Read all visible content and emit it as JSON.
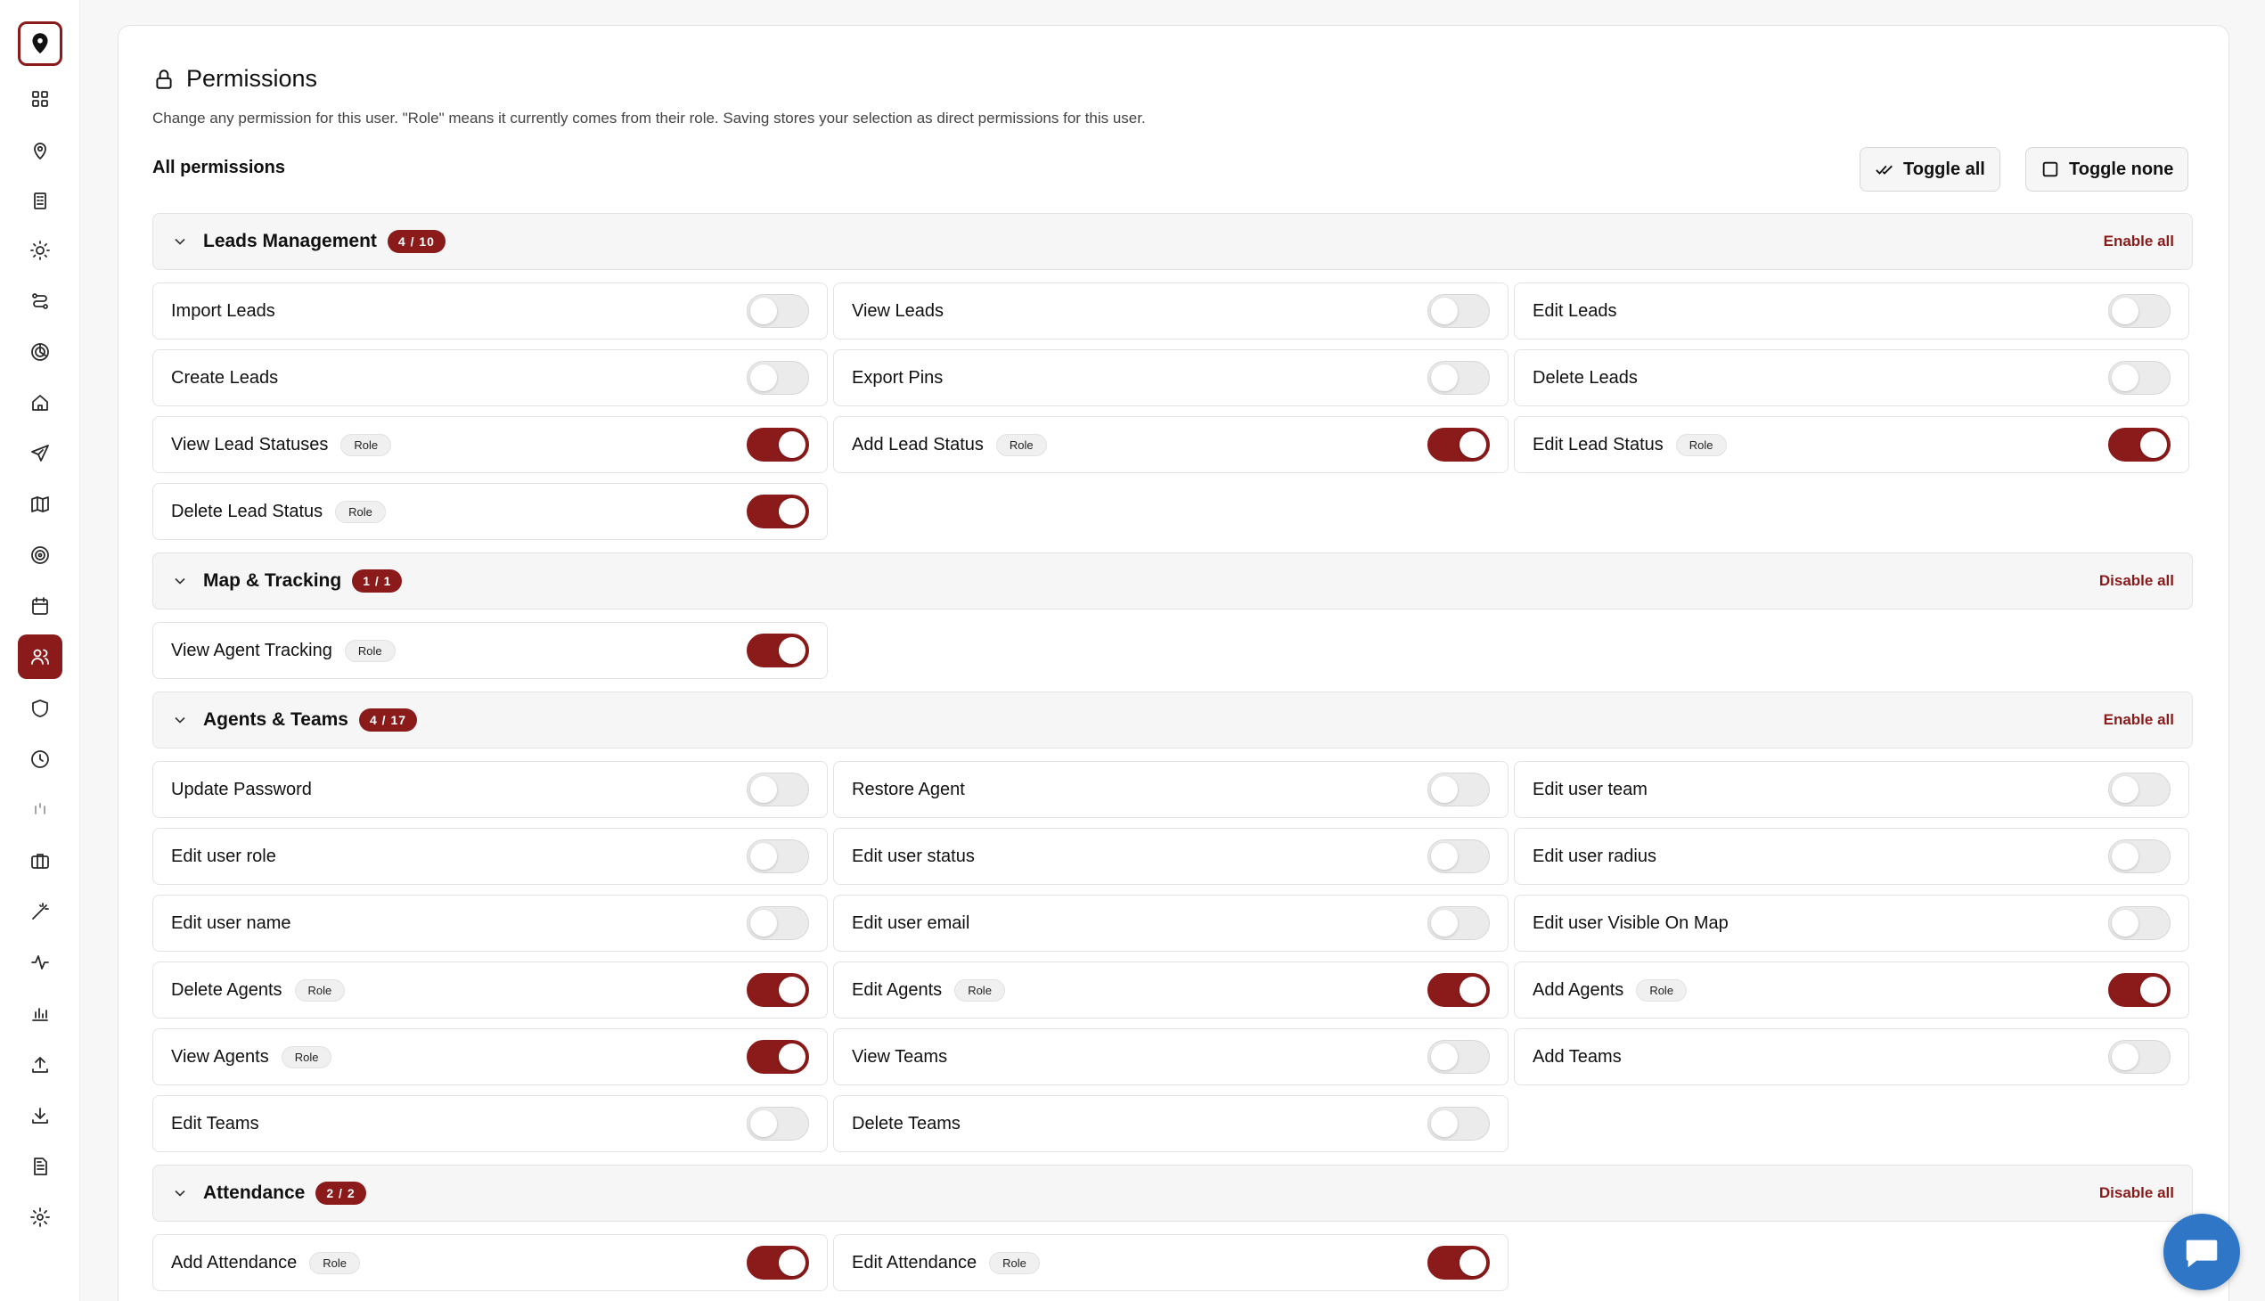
{
  "sidebar": {
    "icons": [
      "map-pin-logo-icon",
      "grid-icon",
      "location-icon",
      "building-icon",
      "sun-icon",
      "route-icon",
      "target-spiral-icon",
      "home-icon",
      "send-icon",
      "map-icon",
      "target-icon",
      "calendar-icon",
      "users-icon",
      "shield-icon",
      "clock-icon",
      "bars-faded-icon",
      "briefcase-icon",
      "magic-wand-icon",
      "activity-icon",
      "bar-chart-icon",
      "upload-icon",
      "download-icon",
      "document-icon",
      "settings-icon"
    ],
    "active": "users-icon"
  },
  "header": {
    "title": "Permissions",
    "description": "Change any permission for this user. \"Role\" means it currently comes from their role. Saving stores your selection as direct permissions for this user.",
    "all_label": "All permissions",
    "toggle_all": "Toggle all",
    "toggle_none": "Toggle none"
  },
  "colors": {
    "accent": "#8b1a1a",
    "chat": "#2f77c6"
  },
  "sections": [
    {
      "title": "Leads Management",
      "count": "4 / 10",
      "action": "Enable all",
      "items": [
        {
          "label": "Import Leads",
          "on": false,
          "role": ""
        },
        {
          "label": "View Leads",
          "on": false,
          "role": ""
        },
        {
          "label": "Edit Leads",
          "on": false,
          "role": ""
        },
        {
          "label": "Create Leads",
          "on": false,
          "role": ""
        },
        {
          "label": "Export Pins",
          "on": false,
          "role": ""
        },
        {
          "label": "Delete Leads",
          "on": false,
          "role": ""
        },
        {
          "label": "View Lead Statuses",
          "on": true,
          "role": "Role"
        },
        {
          "label": "Add Lead Status",
          "on": true,
          "role": "Role"
        },
        {
          "label": "Edit Lead Status",
          "on": true,
          "role": "Role"
        },
        {
          "label": "Delete Lead Status",
          "on": true,
          "role": "Role"
        }
      ]
    },
    {
      "title": "Map & Tracking",
      "count": "1 / 1",
      "action": "Disable all",
      "items": [
        {
          "label": "View Agent Tracking",
          "on": true,
          "role": "Role"
        }
      ]
    },
    {
      "title": "Agents & Teams",
      "count": "4 / 17",
      "action": "Enable all",
      "items": [
        {
          "label": "Update Password",
          "on": false,
          "role": ""
        },
        {
          "label": "Restore Agent",
          "on": false,
          "role": ""
        },
        {
          "label": "Edit user team",
          "on": false,
          "role": ""
        },
        {
          "label": "Edit user role",
          "on": false,
          "role": ""
        },
        {
          "label": "Edit user status",
          "on": false,
          "role": ""
        },
        {
          "label": "Edit user radius",
          "on": false,
          "role": ""
        },
        {
          "label": "Edit user name",
          "on": false,
          "role": ""
        },
        {
          "label": "Edit user email",
          "on": false,
          "role": ""
        },
        {
          "label": "Edit user Visible On Map",
          "on": false,
          "role": ""
        },
        {
          "label": "Delete Agents",
          "on": true,
          "role": "Role"
        },
        {
          "label": "Edit Agents",
          "on": true,
          "role": "Role"
        },
        {
          "label": "Add Agents",
          "on": true,
          "role": "Role"
        },
        {
          "label": "View Agents",
          "on": true,
          "role": "Role"
        },
        {
          "label": "View Teams",
          "on": false,
          "role": ""
        },
        {
          "label": "Add Teams",
          "on": false,
          "role": ""
        },
        {
          "label": "Edit Teams",
          "on": false,
          "role": ""
        },
        {
          "label": "Delete Teams",
          "on": false,
          "role": ""
        }
      ]
    },
    {
      "title": "Attendance",
      "count": "2 / 2",
      "action": "Disable all",
      "items": [
        {
          "label": "Add Attendance",
          "on": true,
          "role": "Role"
        },
        {
          "label": "Edit Attendance",
          "on": true,
          "role": "Role"
        }
      ]
    }
  ]
}
